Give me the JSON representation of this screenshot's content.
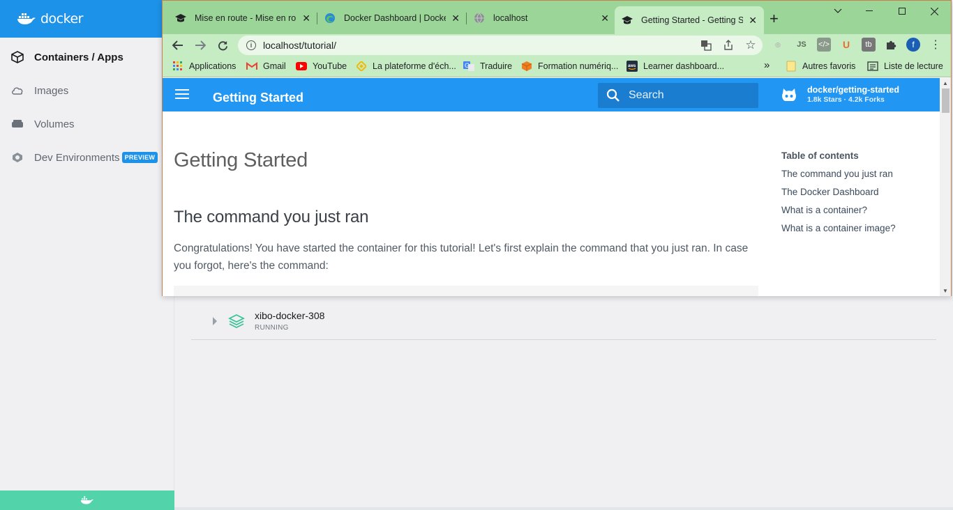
{
  "docker": {
    "brand": "docker",
    "nav": [
      {
        "label": "Containers / Apps",
        "icon": "container-icon",
        "active": true
      },
      {
        "label": "Images",
        "icon": "cloud-icon",
        "active": false
      },
      {
        "label": "Volumes",
        "icon": "volume-icon",
        "active": false
      },
      {
        "label": "Dev Environments",
        "icon": "dev-env-icon",
        "active": false,
        "badge": "PREVIEW"
      }
    ],
    "container": {
      "name": "xibo-docker-308",
      "status": "RUNNING"
    },
    "colors": {
      "brand_blue": "#1d92e9",
      "footer_green": "#52d3aa"
    }
  },
  "chrome": {
    "tabs": [
      {
        "title": "Mise en route - Mise en route",
        "favicon": "graduation-cap-icon",
        "active": false
      },
      {
        "title": "Docker Dashboard | Docker",
        "favicon": "edge-icon",
        "active": false
      },
      {
        "title": "localhost",
        "favicon": "globe-icon",
        "active": false
      },
      {
        "title": "Getting Started - Getting Started",
        "favicon": "graduation-cap-icon",
        "active": true
      }
    ],
    "new_tab": "+",
    "url": "localhost/tutorial/",
    "bookmarks": [
      {
        "label": "Applications",
        "icon": "apps-grid-icon"
      },
      {
        "label": "Gmail",
        "icon": "gmail-icon"
      },
      {
        "label": "YouTube",
        "icon": "youtube-icon"
      },
      {
        "label": "La plateforme d'éch...",
        "icon": "binance-icon"
      },
      {
        "label": "Traduire",
        "icon": "translate-icon"
      },
      {
        "label": "Formation numériq...",
        "icon": "box-icon"
      },
      {
        "label": "Learner dashboard...",
        "icon": "aws-icon"
      }
    ],
    "more_bookmarks": "»",
    "other_bookmarks": "Autres favoris",
    "reading_list": "Liste de lecture",
    "profile_initial": "f",
    "colors": {
      "tabstrip": "#9bd597",
      "toolbar": "#c6ecc3"
    }
  },
  "page": {
    "site_title": "Getting Started",
    "search_placeholder": "Search",
    "repo_name": "docker/getting-started",
    "repo_stats": "1.8k Stars · 4.2k Forks",
    "h1": "Getting Started",
    "h2": "The command you just ran",
    "paragraph": "Congratulations! You have started the container for this tutorial! Let's first explain the command that you just ran. In case you forgot, here's the command:",
    "toc_title": "Table of contents",
    "toc": [
      "The command you just ran",
      "The Docker Dashboard",
      "What is a container?",
      "What is a container image?"
    ],
    "colors": {
      "header": "#2196f3"
    }
  }
}
